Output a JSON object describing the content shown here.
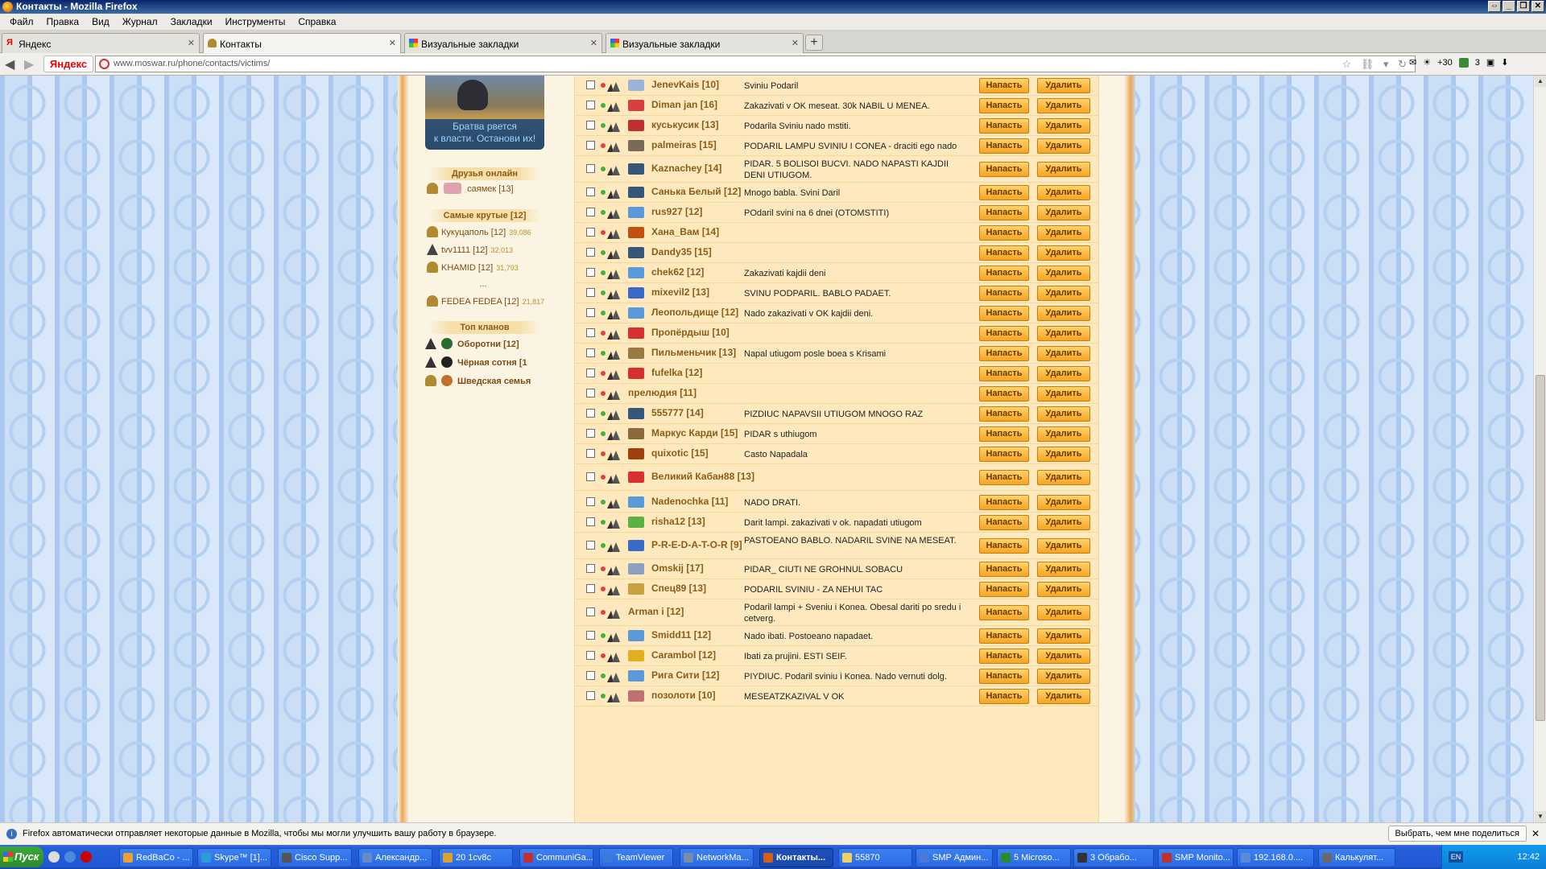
{
  "window": {
    "title": "Контакты - Mozilla Firefox"
  },
  "menu": [
    "Файл",
    "Правка",
    "Вид",
    "Журнал",
    "Закладки",
    "Инструменты",
    "Справка"
  ],
  "tabs": [
    {
      "label": "Яндекс"
    },
    {
      "label": "Контакты"
    },
    {
      "label": "Визуальные закладки"
    },
    {
      "label": "Визуальные закладки"
    }
  ],
  "nav": {
    "yandex_logo": "Яндекс",
    "url": "www.moswar.ru/phone/contacts/victims/",
    "weather": "+30",
    "mail_count": "3"
  },
  "sidebar": {
    "promo_line1": "Братва рвется",
    "promo_line2": "к власти. Останови их!",
    "friends_title": "Друзья онлайн",
    "friends": [
      {
        "name": "саямек [13]"
      }
    ],
    "top_title": "Самые крутые [12]",
    "top": [
      {
        "name": "Кукуцаполь [12]",
        "points": "39,086"
      },
      {
        "name": "tvv1111 [12]",
        "points": "32,013"
      },
      {
        "name": "KHAMID [12]",
        "points": "31,793"
      },
      {
        "name": "...",
        "points": ""
      },
      {
        "name": "FEDEA FEDEA [12]",
        "points": "21,817"
      }
    ],
    "clans_title": "Топ кланов",
    "clans": [
      {
        "name": "Оборотни [12]"
      },
      {
        "name": "Чёрная сотня [1"
      },
      {
        "name": "Шведская семья"
      }
    ]
  },
  "labels": {
    "attack": "Напасть",
    "delete": "Удалить"
  },
  "rows": [
    {
      "nick": "JenevKais [10]",
      "note": "Sviniu Podaril",
      "status": "red",
      "color": "#9bb3d8"
    },
    {
      "nick": "Diman jan [16]",
      "note": "Zakazivati v OK meseat. 30k NABIL U MENEA.",
      "status": "green",
      "color": "#d84040"
    },
    {
      "nick": "куськусик [13]",
      "note": "Podarila Sviniu nado mstiti.",
      "status": "green",
      "color": "#c03030"
    },
    {
      "nick": "palmeiras [15]",
      "note": "PODARIL LAMPU SVINIU I CONEA - draciti ego nado",
      "status": "red",
      "color": "#7a6a5a"
    },
    {
      "nick": "Kaznachey [14]",
      "note": "PIDAR. 5 BOLISOI BUCVI. NADO NAPASTI KAJDII DENI UTIUGOM.",
      "status": "green",
      "color": "#36567a"
    },
    {
      "nick": "Санька Белый [12]",
      "note": "Mnogo babla. Svini Daril",
      "status": "green",
      "color": "#36567a"
    },
    {
      "nick": "rus927 [12]",
      "note": "POdaril svini na 6 dnei (OTOMSTITI)",
      "status": "green",
      "color": "#5a9ad8"
    },
    {
      "nick": "Хана_Вам [14]",
      "note": "",
      "status": "red",
      "color": "#c05010"
    },
    {
      "nick": "Dandy35 [15]",
      "note": "",
      "status": "green",
      "color": "#36567a"
    },
    {
      "nick": "chek62 [12]",
      "note": "Zakazivati kajdii deni",
      "status": "green",
      "color": "#5a9ad8"
    },
    {
      "nick": "mixevil2 [13]",
      "note": "SVINU PODPARIL. BABLO PADAET.",
      "status": "green",
      "color": "#3a6ac8"
    },
    {
      "nick": "Леопольдище [12]",
      "note": "Nado zakazivati v OK kajdii deni.",
      "status": "green",
      "color": "#5a9ad8"
    },
    {
      "nick": "Пропёрдыш [10]",
      "note": "",
      "status": "red",
      "color": "#d83030"
    },
    {
      "nick": "Пильменьчик [13]",
      "note": "Napal utiugom posle boea s Krisami",
      "status": "green",
      "color": "#9a7a40"
    },
    {
      "nick": "fufelka [12]",
      "note": "",
      "status": "red",
      "color": "#d83030"
    },
    {
      "nick": "прелюдия [11]",
      "note": "",
      "status": "red",
      "color": ""
    },
    {
      "nick": "555777 [14]",
      "note": "PIZDIUC NAPAVSII UTIUGOM MNOGO RAZ",
      "status": "green",
      "color": "#36567a"
    },
    {
      "nick": "Маркус Карди [15]",
      "note": "PIDAR s uthiugom",
      "status": "green",
      "color": "#8a6a3a"
    },
    {
      "nick": "quixotic [15]",
      "note": "Casto Napadala",
      "status": "red",
      "color": "#a04010"
    },
    {
      "nick": "Великий Кабан88 [13]",
      "note": "",
      "status": "red",
      "color": "#d83030"
    },
    {
      "nick": "Nadenochka [11]",
      "note": "NADO DRATI.",
      "status": "green",
      "color": "#5a9ad8"
    },
    {
      "nick": "risha12 [13]",
      "note": "Darit lampi. zakazivati v ok. napadati utiugom",
      "status": "green",
      "color": "#5ab040"
    },
    {
      "nick": "P-R-E-D-A-T-O-R [9]",
      "note": "PASTOEANO BABLO. NADARIL SVINE NA MESEAT.",
      "status": "green",
      "color": "#3a6ac8"
    },
    {
      "nick": "Omskij [17]",
      "note": "PIDAR_ CIUTI NE GROHNUL SOBACU",
      "status": "red",
      "color": "#8aa0c0"
    },
    {
      "nick": "Спец89 [13]",
      "note": "PODARIL SVINIU - ZA NEHUI TAC",
      "status": "red",
      "color": "#c8a040"
    },
    {
      "nick": "Arman i [12]",
      "note": "Podaril lampi + Sveniu i Konea. Obesal dariti po sredu i cetverg.",
      "status": "red",
      "color": ""
    },
    {
      "nick": "Smidd11 [12]",
      "note": "Nado ibati. Postoeano napadaet.",
      "status": "green",
      "color": "#5a9ad8"
    },
    {
      "nick": "Carambol [12]",
      "note": "Ibati za prujini. ESTI SEIF.",
      "status": "red",
      "color": "#e0b020"
    },
    {
      "nick": "Рига Сити [12]",
      "note": "PIYDIUC. Podaril sviniu i Konea. Nado vernuti dolg.",
      "status": "green",
      "color": "#5a9ad8"
    },
    {
      "nick": "позолоти [10]",
      "note": "MESEATZKAZIVAL V OK",
      "status": "green",
      "color": "#c07070"
    }
  ],
  "notification": {
    "text": "Firefox автоматически отправляет некоторые данные в Mozilla, чтобы мы могли улучшить вашу работу в браузере.",
    "button": "Выбрать, чем мне поделиться"
  },
  "taskbar": {
    "start": "Пуск",
    "items": [
      {
        "label": "RedBaCo - ..."
      },
      {
        "label": "Skype™ [1]..."
      },
      {
        "label": "Cisco Supp..."
      },
      {
        "label": "Александр..."
      },
      {
        "label": "20 1cv8c"
      },
      {
        "label": "CommuniGa..."
      },
      {
        "label": "TeamViewer"
      },
      {
        "label": "NetworkMa..."
      },
      {
        "label": "Контакты..."
      },
      {
        "label": "55870"
      },
      {
        "label": "SMP Админ..."
      },
      {
        "label": "5 Microso..."
      },
      {
        "label": "3 Обрабо..."
      },
      {
        "label": "SMP Monito..."
      },
      {
        "label": "192.168.0...."
      },
      {
        "label": "Калькулят..."
      }
    ],
    "lang": "EN",
    "clock": "12:42"
  },
  "colors": {
    "accent": "#f6a422",
    "page_bg": "#fbf4e3",
    "table_bg": "#fde9bd",
    "nick": "#8b5b1a"
  }
}
